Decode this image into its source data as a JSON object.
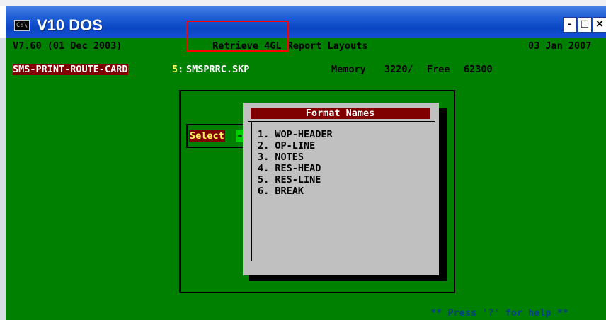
{
  "window": {
    "title": "V10 DOS",
    "icon": "console-icon",
    "minimize_label": "-",
    "maximize_label": "□",
    "close_label": "×"
  },
  "statusline": {
    "version": "V7.60 (01 Dec 2003)",
    "screen_title": "Retrieve 4GL Report Layouts",
    "date": "03 Jan 2007"
  },
  "infoline": {
    "program": "SMS-PRINT-ROUTE-CARD",
    "file_no": "5",
    "file_sep": ":",
    "filename": "SMSPRRC.SKP",
    "memory_label": "Memory",
    "memory_value": "3220/",
    "free_label": "Free",
    "free_value": "62300"
  },
  "select": {
    "label": "Select",
    "arrow": "→"
  },
  "popup": {
    "title": "Format Names",
    "items": [
      {
        "num": "1.",
        "label": "WOP-HEADER"
      },
      {
        "num": "2.",
        "label": "OP-LINE"
      },
      {
        "num": "3.",
        "label": "NOTES"
      },
      {
        "num": "4.",
        "label": "RES-HEAD"
      },
      {
        "num": "5.",
        "label": "RES-LINE"
      },
      {
        "num": "6.",
        "label": "BREAK"
      }
    ]
  },
  "footer": {
    "help_text": "** Press '?' for help **"
  },
  "colors": {
    "console_bg": "#008000",
    "highlight_bg": "#800000",
    "popup_bg": "#c0c0c0",
    "annotation": "#ff0000"
  }
}
